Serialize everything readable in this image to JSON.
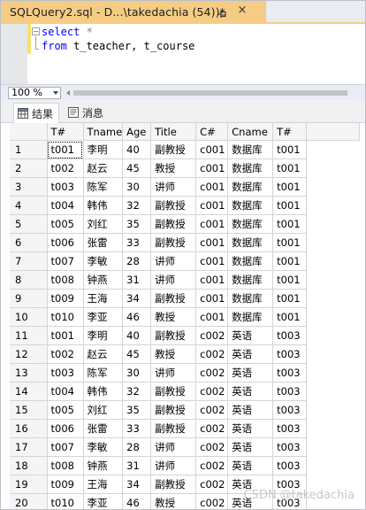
{
  "document_tab": {
    "title": "SQLQuery2.sql - D...\\takedachia (54))*",
    "pin_icon": "pin-icon",
    "close_glyph": "×"
  },
  "editor": {
    "lines": [
      {
        "keyword": "select",
        "rest": " *"
      },
      {
        "keyword": "from",
        "rest": " t_teacher, t_course"
      }
    ]
  },
  "zoom": {
    "value": "100 %"
  },
  "result_tabs": [
    {
      "label": "结果",
      "icon": "grid-results-icon",
      "active": true
    },
    {
      "label": "消息",
      "icon": "messages-icon",
      "active": false
    }
  ],
  "grid": {
    "columns": [
      "T#",
      "Tname",
      "Age",
      "Title",
      "C#",
      "Cname",
      "T#"
    ],
    "rows": [
      {
        "n": "1",
        "cells": [
          "t001",
          "李明",
          "40",
          "副教授",
          "c001",
          "数据库",
          "t001"
        ]
      },
      {
        "n": "2",
        "cells": [
          "t002",
          "赵云",
          "45",
          "教授",
          "c001",
          "数据库",
          "t001"
        ]
      },
      {
        "n": "3",
        "cells": [
          "t003",
          "陈军",
          "30",
          "讲师",
          "c001",
          "数据库",
          "t001"
        ]
      },
      {
        "n": "4",
        "cells": [
          "t004",
          "韩伟",
          "32",
          "副教授",
          "c001",
          "数据库",
          "t001"
        ]
      },
      {
        "n": "5",
        "cells": [
          "t005",
          "刘红",
          "35",
          "副教授",
          "c001",
          "数据库",
          "t001"
        ]
      },
      {
        "n": "6",
        "cells": [
          "t006",
          "张雷",
          "33",
          "副教授",
          "c001",
          "数据库",
          "t001"
        ]
      },
      {
        "n": "7",
        "cells": [
          "t007",
          "李敏",
          "28",
          "讲师",
          "c001",
          "数据库",
          "t001"
        ]
      },
      {
        "n": "8",
        "cells": [
          "t008",
          "钟燕",
          "31",
          "讲师",
          "c001",
          "数据库",
          "t001"
        ]
      },
      {
        "n": "9",
        "cells": [
          "t009",
          "王海",
          "34",
          "副教授",
          "c001",
          "数据库",
          "t001"
        ]
      },
      {
        "n": "10",
        "cells": [
          "t010",
          "李亚",
          "46",
          "教授",
          "c001",
          "数据库",
          "t001"
        ]
      },
      {
        "n": "11",
        "cells": [
          "t001",
          "李明",
          "40",
          "副教授",
          "c002",
          "英语",
          "t003"
        ]
      },
      {
        "n": "12",
        "cells": [
          "t002",
          "赵云",
          "45",
          "教授",
          "c002",
          "英语",
          "t003"
        ]
      },
      {
        "n": "13",
        "cells": [
          "t003",
          "陈军",
          "30",
          "讲师",
          "c002",
          "英语",
          "t003"
        ]
      },
      {
        "n": "14",
        "cells": [
          "t004",
          "韩伟",
          "32",
          "副教授",
          "c002",
          "英语",
          "t003"
        ]
      },
      {
        "n": "15",
        "cells": [
          "t005",
          "刘红",
          "35",
          "副教授",
          "c002",
          "英语",
          "t003"
        ]
      },
      {
        "n": "16",
        "cells": [
          "t006",
          "张雷",
          "33",
          "副教授",
          "c002",
          "英语",
          "t003"
        ]
      },
      {
        "n": "17",
        "cells": [
          "t007",
          "李敏",
          "28",
          "讲师",
          "c002",
          "英语",
          "t003"
        ]
      },
      {
        "n": "18",
        "cells": [
          "t008",
          "钟燕",
          "31",
          "讲师",
          "c002",
          "英语",
          "t003"
        ]
      },
      {
        "n": "19",
        "cells": [
          "t009",
          "王海",
          "34",
          "副教授",
          "c002",
          "英语",
          "t003"
        ]
      },
      {
        "n": "20",
        "cells": [
          "t010",
          "李亚",
          "46",
          "教授",
          "c002",
          "英语",
          "t003"
        ]
      }
    ]
  },
  "watermark": "CSDN @takedachia"
}
